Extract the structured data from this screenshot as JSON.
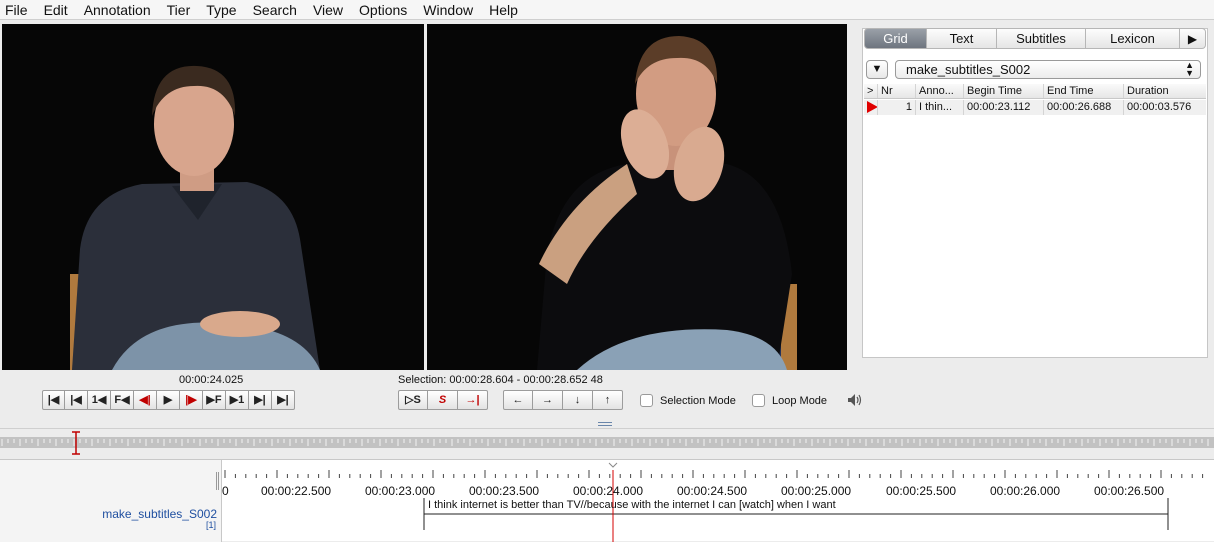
{
  "menu": [
    "File",
    "Edit",
    "Annotation",
    "Tier",
    "Type",
    "Search",
    "View",
    "Options",
    "Window",
    "Help"
  ],
  "panel": {
    "tabs": [
      "Grid",
      "Text",
      "Subtitles",
      "Lexicon"
    ],
    "tab_more": "▶",
    "active_tab": "Grid",
    "tier_toggle": "▼",
    "tier_selected": "make_subtitles_S002",
    "columns": [
      ">",
      "Nr",
      "Anno...",
      "Begin Time",
      "End Time",
      "Duration"
    ],
    "rows": [
      {
        "nr": "1",
        "annotation": "I thin...",
        "begin": "00:00:23.112",
        "end": "00:00:26.688",
        "duration": "00:00:03.576"
      }
    ]
  },
  "controls": {
    "current_time": "00:00:24.025",
    "selection": "Selection: 00:00:28.604 - 00:00:28.652  48",
    "nav_buttons": [
      "|◀",
      "|◀",
      "1◀",
      "F◀",
      "◀|",
      "▶",
      "|▶",
      "▶F",
      "▶1",
      "▶|",
      "▶|"
    ],
    "selection_buttons": [
      "▷S",
      "S",
      "→|"
    ],
    "arrow_buttons": [
      "←",
      "→",
      "↓",
      "↑"
    ],
    "selection_mode_label": "Selection Mode",
    "loop_mode_label": "Loop Mode",
    "volume_icon": "speaker-icon"
  },
  "timeline": {
    "ticks": [
      "0",
      "00:00:22.500",
      "00:00:23.000",
      "00:00:23.500",
      "00:00:24.000",
      "00:00:24.500",
      "00:00:25.000",
      "00:00:25.500",
      "00:00:26.000",
      "00:00:26.500"
    ],
    "tier_name": "make_subtitles_S002",
    "tier_count": "[1]",
    "annotation": "I think internet is better than TV//because with the internet I can [watch] when I want"
  },
  "colors": {
    "accent_red": "#e00000",
    "tier_blue": "#1f4fa0",
    "tab_active": "#7d848e"
  }
}
